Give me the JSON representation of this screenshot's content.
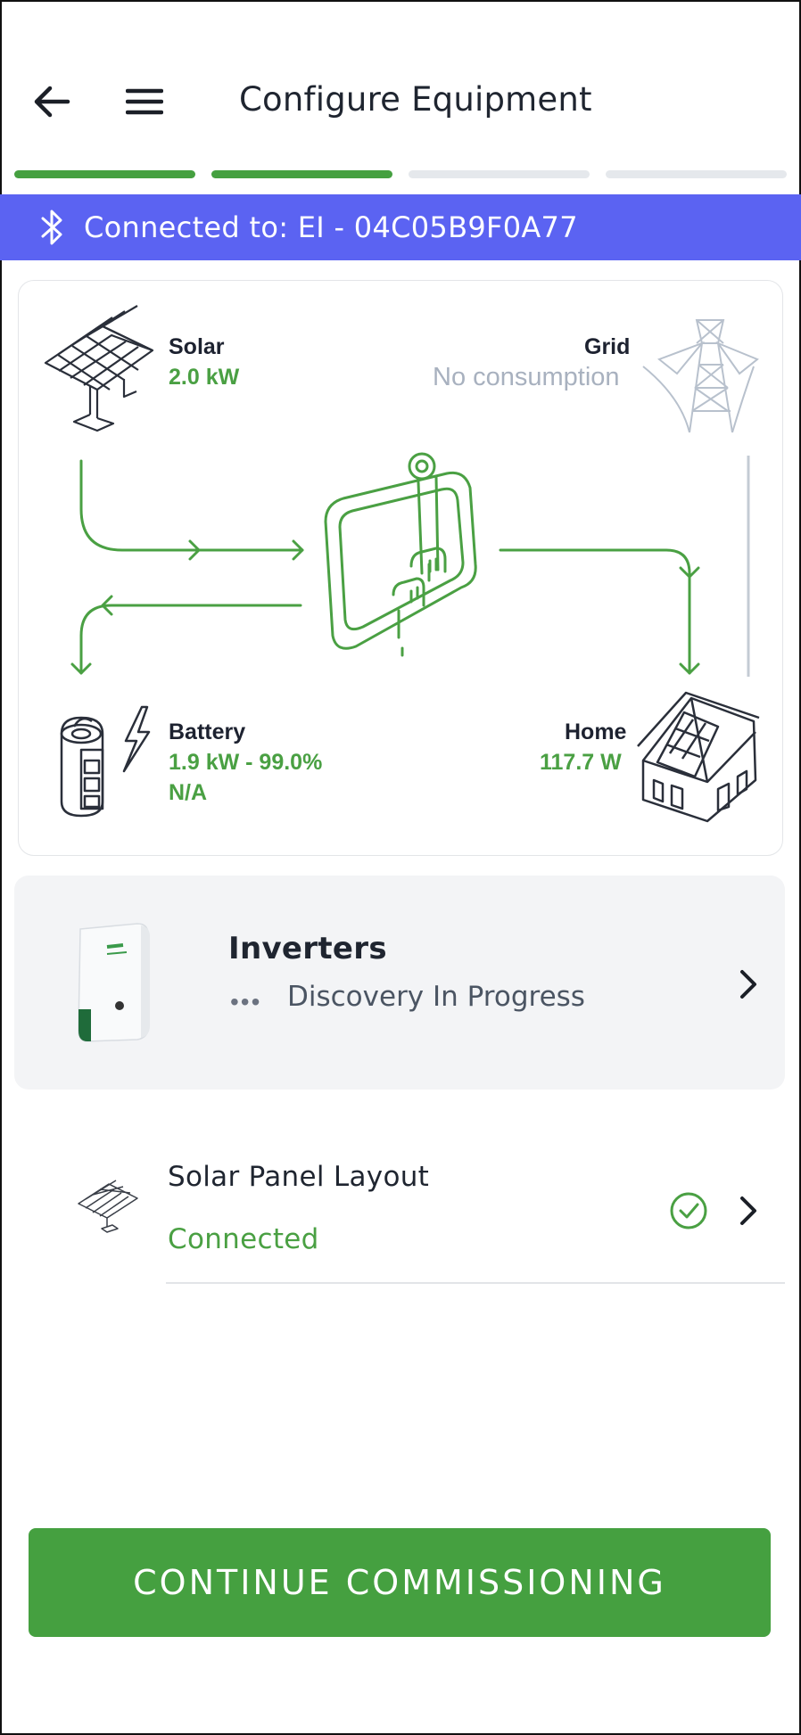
{
  "header": {
    "title": "Configure Equipment",
    "back_icon": "arrow-left-icon",
    "menu_icon": "hamburger-menu-icon"
  },
  "stepper": {
    "total_steps": 4,
    "completed_steps": 2,
    "active_color": "#45a040",
    "inactive_color": "#e5e8ec"
  },
  "bluetooth": {
    "icon": "bluetooth-icon",
    "text": "Connected to: EI - 04C05B9F0A77",
    "color": "#5b63f2"
  },
  "energy_flow": {
    "solar": {
      "label": "Solar",
      "value": "2.0 kW"
    },
    "grid": {
      "label": "Grid",
      "value": "No consumption"
    },
    "battery": {
      "label": "Battery",
      "value": "1.9 kW - 99.0%",
      "secondary": "N/A"
    },
    "home": {
      "label": "Home",
      "value": "117.7 W"
    },
    "flow_color": "#4aa043",
    "idle_color": "#c4cbd4"
  },
  "inverters": {
    "title": "Inverters",
    "status_dots": "•••",
    "status": "Discovery In Progress"
  },
  "solar_panel_layout": {
    "title": "Solar Panel Layout",
    "status": "Connected"
  },
  "cta": {
    "label": "CONTINUE COMMISSIONING",
    "color": "#45a040"
  }
}
